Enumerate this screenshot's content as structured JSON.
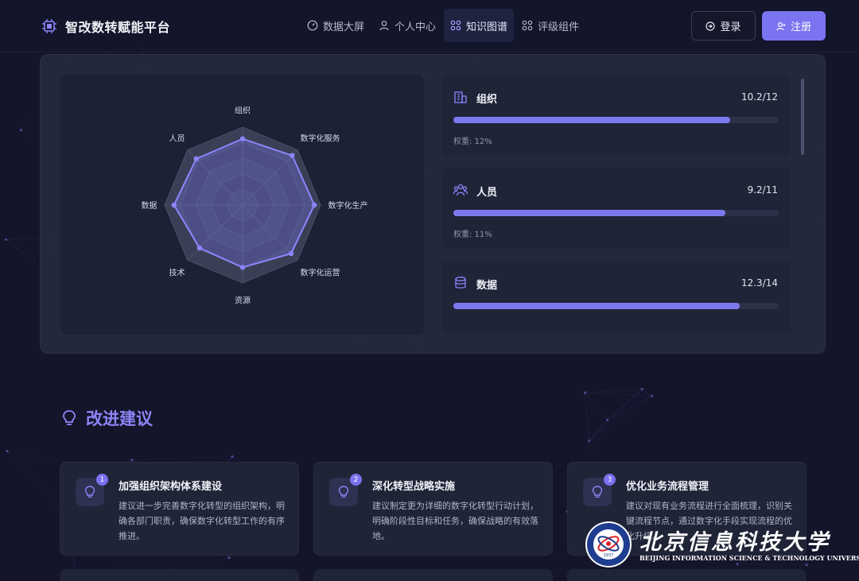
{
  "header": {
    "brand_title": "智改数转赋能平台",
    "nav": [
      {
        "label": "数据大屏",
        "icon": "gauge-icon",
        "active": false
      },
      {
        "label": "个人中心",
        "icon": "user-icon",
        "active": false
      },
      {
        "label": "知识图谱",
        "icon": "grid-icon",
        "active": true
      },
      {
        "label": "评级组件",
        "icon": "grid-icon",
        "active": false
      }
    ],
    "login_label": "登录",
    "register_label": "注册"
  },
  "radar": {
    "axes": [
      "组织",
      "数字化服务",
      "数字化生产",
      "数字化运营",
      "资源",
      "技术",
      "数据",
      "人员"
    ],
    "values": [
      0.85,
      0.9,
      0.92,
      0.88,
      0.8,
      0.78,
      0.88,
      0.84
    ],
    "colors": {
      "fill": "#7c79ee",
      "stroke": "#8b86ff",
      "grid": "#4a4f66"
    }
  },
  "metrics": [
    {
      "name": "组织",
      "score": "10.2/12",
      "progress": 0.85,
      "weight": "权重: 12%",
      "icon": "building-icon"
    },
    {
      "name": "人员",
      "score": "9.2/11",
      "progress": 0.836,
      "weight": "权重: 11%",
      "icon": "people-icon"
    },
    {
      "name": "数据",
      "score": "12.3/14",
      "progress": 0.879,
      "weight": "",
      "icon": "database-icon"
    }
  ],
  "suggestions": {
    "title": "改进建议",
    "items": [
      {
        "num": "1",
        "title": "加强组织架构体系建设",
        "body": "建议进一步完善数字化转型的组织架构，明确各部门职责，确保数字化转型工作的有序推进。"
      },
      {
        "num": "2",
        "title": "深化转型战略实施",
        "body": "建议制定更为详细的数字化转型行动计划，明确阶段性目标和任务，确保战略的有效落地。"
      },
      {
        "num": "3",
        "title": "优化业务流程管理",
        "body": "建议对现有业务流程进行全面梳理，识别关键流程节点，通过数字化手段实现流程的优化升级。"
      }
    ]
  },
  "watermark": {
    "cn": "北京信息科技大学",
    "en": "BEIJING INFORMATION SCIENCE & TECHNOLOGY UNIVERSITY",
    "seal_year": "1937"
  },
  "theme": {
    "accent": "#7b74f0",
    "background": "#14152b",
    "card": "#1f2437"
  }
}
